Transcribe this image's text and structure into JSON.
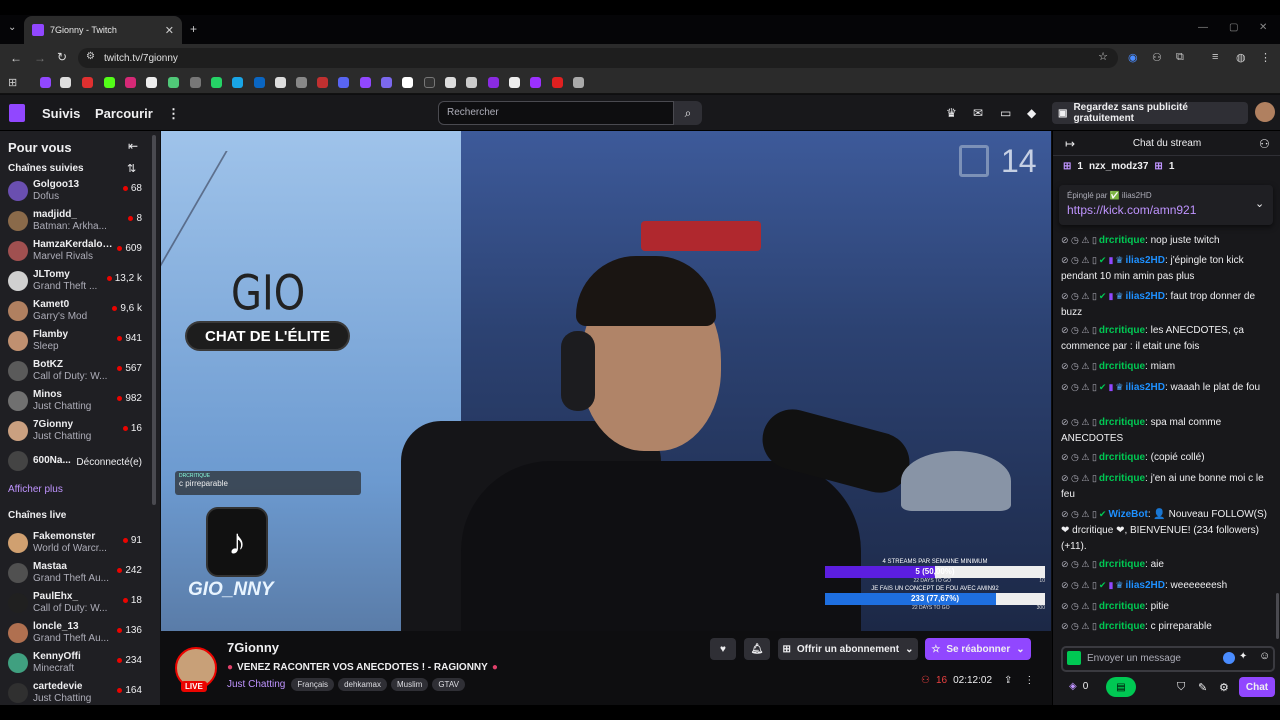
{
  "browser": {
    "tab_title": "7Gionny - Twitch",
    "url": "twitch.tv/7gionny"
  },
  "nav": {
    "following": "Suivis",
    "browse": "Parcourir",
    "more": "⋮",
    "search_placeholder": "Rechercher",
    "adfree_label": "Regardez sans publicité gratuitement"
  },
  "sidebar": {
    "title": "Pour vous",
    "followed_title": "Chaînes suivies",
    "show_more": "Afficher plus",
    "live_title": "Chaînes live",
    "followed": [
      {
        "name": "Golgoo13",
        "game": "Dofus",
        "viewers": "68",
        "color": "#6a4fb0"
      },
      {
        "name": "madjidd_",
        "game": "Batman: Arkha...",
        "viewers": "8",
        "color": "#8a6a4a"
      },
      {
        "name": "HamzaKerdaloco",
        "game": "Marvel Rivals",
        "viewers": "609",
        "color": "#a05050"
      },
      {
        "name": "JLTomy",
        "game": "Grand Theft ...",
        "viewers": "13,2 k",
        "color": "#d0d0d0"
      },
      {
        "name": "Kamet0",
        "game": "Garry's Mod",
        "viewers": "9,6 k",
        "color": "#b08060"
      },
      {
        "name": "Flamby",
        "game": "Sleep",
        "viewers": "941",
        "color": "#c09070"
      },
      {
        "name": "BotKZ",
        "game": "Call of Duty: W...",
        "viewers": "567",
        "color": "#5a5a5a"
      },
      {
        "name": "Minos",
        "game": "Just Chatting",
        "viewers": "982",
        "color": "#707070"
      },
      {
        "name": "7Gionny",
        "game": "Just Chatting",
        "viewers": "16",
        "color": "#caa080"
      },
      {
        "name": "600Na...",
        "game": "",
        "viewers": "Déconnecté(e)",
        "color": "#444"
      }
    ],
    "live": [
      {
        "name": "Fakemonster",
        "game": "World of Warcr...",
        "viewers": "91",
        "color": "#d0a070"
      },
      {
        "name": "Mastaa",
        "game": "Grand Theft Au...",
        "viewers": "242",
        "color": "#505050"
      },
      {
        "name": "PaulEhx_",
        "game": "Call of Duty: W...",
        "viewers": "18",
        "color": "#202020"
      },
      {
        "name": "loncle_13",
        "game": "Grand Theft Au...",
        "viewers": "136",
        "color": "#b07050"
      },
      {
        "name": "KennyOffi",
        "game": "Minecraft",
        "viewers": "234",
        "color": "#40a080"
      },
      {
        "name": "cartedevie",
        "game": "Just Chatting",
        "viewers": "164",
        "color": "#303030"
      }
    ]
  },
  "stream": {
    "overlay_banner": "CHAT DE L'ÉLITE",
    "overlay_counter": "14",
    "overlay_chat_user": "DRCRITIQUE",
    "overlay_chat_text": "c pirreparable",
    "tiktok_handle": "GIO_NNY",
    "wall_text": "GIO",
    "goal1_title": "4 STREAMS PAR SEMAINE MINIMUM",
    "goal1_value": "5 (50,00%)",
    "goal1_fraction": 0.5,
    "goal1_sub": "22 DAYS TO GO",
    "goal1_end": "10",
    "goal2_title": "JE FAIS UN CONCEPT DE FOU AVEC AMIN92",
    "goal2_value": "233 (77,67%)",
    "goal2_fraction": 0.7767,
    "goal2_sub": "22 DAYS TO GO",
    "goal2_end": "300"
  },
  "channel": {
    "name": "7Gionny",
    "live_badge": "LIVE",
    "title": "VENEZ RACONTER VOS ANECDOTES ! - RAGIONNY",
    "category": "Just Chatting",
    "tags": [
      "Français",
      "dehkamax",
      "Muslim",
      "GTAV"
    ],
    "viewers": "16",
    "uptime": "02:12:02",
    "gift_label": "Offrir un abonnement",
    "resub_label": "Se réabonner"
  },
  "chat": {
    "title": "Chat du stream",
    "top_gifter_count1": "1",
    "top_gifter_name": "nzx_modz37",
    "top_gifter_count2": "1",
    "pinned_by": "Épinglé par ✅ ilias2HD",
    "pinned_link": "https://kick.com/amn921",
    "messages": [
      {
        "user": "drcritique",
        "color": "#00c853",
        "text": "nop juste twitch"
      },
      {
        "user": "ilias2HD",
        "color": "#1e90ff",
        "text": "j'épingle ton kick pendant 10 min amin pas plus"
      },
      {
        "user": "ilias2HD",
        "color": "#1e90ff",
        "text": "faut trop donner de buzz"
      },
      {
        "user": "drcritique",
        "color": "#00c853",
        "text": "les ANECDOTES, ça commence par : il etait une fois"
      },
      {
        "user": "drcritique",
        "color": "#00c853",
        "text": "miam"
      },
      {
        "user": "ilias2HD",
        "color": "#1e90ff",
        "text": "waaah le plat de fou"
      },
      {
        "user": "drcritique",
        "color": "#00c853",
        "text": "spa mal comme ANECDOTES"
      },
      {
        "user": "drcritique",
        "color": "#00c853",
        "text": "(copié collé)"
      },
      {
        "user": "drcritique",
        "color": "#00c853",
        "text": "j'en ai une bonne moi c le feu"
      },
      {
        "user": "WizeBot",
        "color": "#1e90ff",
        "text": "👤 Nouveau FOLLOW(S) ❤ drcritique ❤, BIENVENUE! (234 followers) (+11)."
      },
      {
        "user": "drcritique",
        "color": "#00c853",
        "text": "aie"
      },
      {
        "user": "ilias2HD",
        "color": "#1e90ff",
        "text": "weeeeeeesh"
      },
      {
        "user": "drcritique",
        "color": "#00c853",
        "text": "pitie"
      },
      {
        "user": "drcritique",
        "color": "#00c853",
        "text": "c pirreparable"
      }
    ],
    "input_placeholder": "Envoyer un message",
    "points": "0",
    "chat_button": "Chat"
  }
}
